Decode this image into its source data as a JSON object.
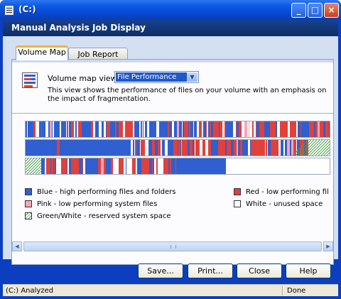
{
  "window": {
    "title": "(C:)",
    "minimize": "_",
    "maximize": "□",
    "close": "×"
  },
  "header": {
    "title": "Manual Analysis Job Display"
  },
  "tabs": [
    {
      "label": "Volume Map"
    },
    {
      "label": "Job Report"
    }
  ],
  "volume_map": {
    "view_label": "Volume map view:",
    "view_value": "File Performance",
    "description": "This view shows the performance of files on your volume with an emphasis on the impact of fragmentation."
  },
  "legend": [
    {
      "label": "Blue - high performing files and folders",
      "color": "#2f5fd0"
    },
    {
      "label": "Red - low performing files and folders",
      "color": "#e0413a"
    },
    {
      "label": "Pink - low performing system files",
      "color": "#f4a5b8"
    },
    {
      "label": "White - unused space",
      "color": "#ffffff"
    },
    {
      "label": "Green/White - reserved system space",
      "color": "#4aa24a"
    }
  ],
  "buttons": {
    "save": "Save...",
    "print": "Print...",
    "close": "Close",
    "help": "Help"
  },
  "status": {
    "left": "(C:) Analyzed",
    "right": "Done"
  },
  "colors": {
    "blue": "#2f5fd0",
    "red": "#e0413a",
    "pink": "#f4a5b8",
    "white": "#ffffff",
    "green": "#4aa24a"
  }
}
